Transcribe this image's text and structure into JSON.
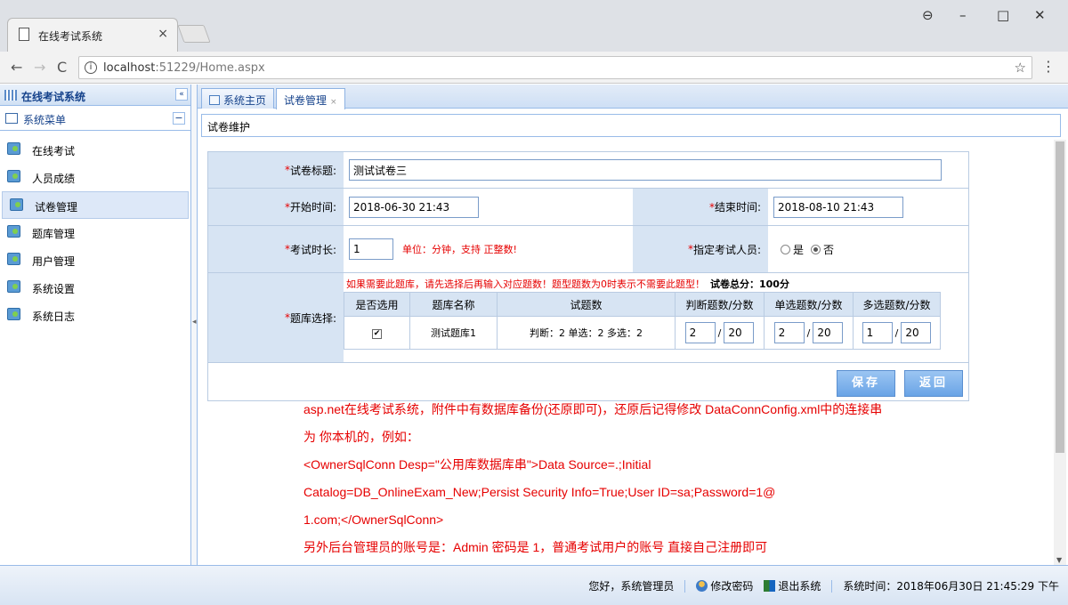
{
  "browser": {
    "tab_title": "在线考试系统",
    "tab_close": "×",
    "url_host": "localhost",
    "url_rest": ":51229/Home.aspx",
    "info": "i",
    "back": "←",
    "forward": "→",
    "reload": "C",
    "star": "☆",
    "menu": "⋮",
    "win_account": "⊖",
    "win_min": "–",
    "win_max": "□",
    "win_close": "✕"
  },
  "sidebar": {
    "title": "在线考试系统",
    "collapse": "«",
    "menu_title": "系统菜单",
    "minimize": "−",
    "items": [
      {
        "label": "在线考试"
      },
      {
        "label": "人员成绩"
      },
      {
        "label": "试卷管理"
      },
      {
        "label": "题库管理"
      },
      {
        "label": "用户管理"
      },
      {
        "label": "系统设置"
      },
      {
        "label": "系统日志"
      }
    ]
  },
  "content": {
    "tabs": [
      {
        "label": "系统主页"
      },
      {
        "label": "试卷管理",
        "close": "×"
      }
    ],
    "panel_title": "试卷维护"
  },
  "form": {
    "title_label": "试卷标题:",
    "title_value": "测试试卷三",
    "start_label": "开始时间:",
    "start_value": "2018-06-30 21:43",
    "end_label": "结束时间:",
    "end_value": "2018-08-10 21:43",
    "duration_label": "考试时长:",
    "duration_value": "1",
    "duration_hint": "单位：分钟，支持 正整数!",
    "assign_label": "指定考试人员:",
    "assign_yes": "是",
    "assign_no": "否",
    "bank_label": "题库选择:",
    "bank_note": "如果需要此题库，请先选择后再输入对应题数！题型题数为0时表示不需要此题型！",
    "total_score": "试卷总分：100分",
    "bank_headers": [
      "是否选用",
      "题库名称",
      "试题数",
      "判断题数/分数",
      "单选题数/分数",
      "多选题数/分数"
    ],
    "bank_rows": [
      {
        "checked": "✔",
        "name": "测试题库1",
        "count": "判断：2 单选：2 多选：2",
        "judge_n": "2",
        "judge_s": "20",
        "single_n": "2",
        "single_s": "20",
        "multi_n": "1",
        "multi_s": "20"
      }
    ],
    "slash": "/",
    "save": "保存",
    "back": "返回"
  },
  "notes": [
    "asp.net在线考试系统，附件中有数据库备份(还原即可)，还原后记得修改 DataConnConfig.xml中的连接串",
    "为 你本机的，例如：",
    "<OwnerSqlConn Desp=\"公用库数据库串\">Data Source=.;Initial",
    "Catalog=DB_OnlineExam_New;Persist Security Info=True;User ID=sa;Password=1@",
    "1.com;</OwnerSqlConn>",
    "另外后台管理员的账号是：Admin 密码是 1，普通考试用户的账号 直接自己注册即可"
  ],
  "status": {
    "greeting": "您好，系统管理员",
    "change_pwd": "修改密码",
    "logout": "退出系统",
    "time_label": "系统时间：",
    "time_value": "2018年06月30日 21:45:29 下午"
  }
}
